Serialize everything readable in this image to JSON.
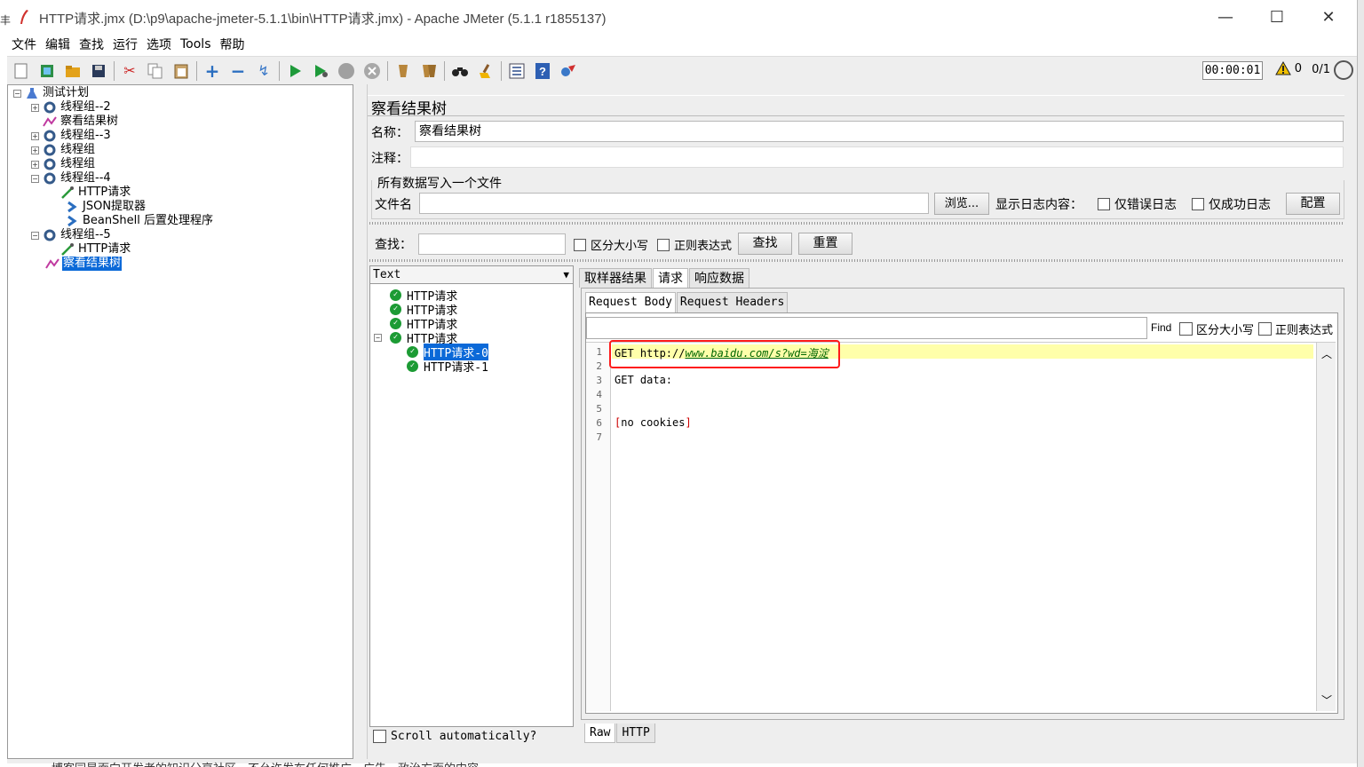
{
  "window": {
    "title": "HTTP请求.jmx (D:\\p9\\apache-jmeter-5.1.1\\bin\\HTTP请求.jmx) - Apache JMeter (5.1.1 r1855137)",
    "edge_glyph": "丰",
    "minimize": "—",
    "maximize": "☐",
    "close": "✕"
  },
  "menu": [
    "文件",
    "编辑",
    "查找",
    "运行",
    "选项",
    "Tools",
    "帮助"
  ],
  "toolbar": {
    "timer": "00:00:01",
    "warnings": "0",
    "threads": "0/1"
  },
  "tree": [
    {
      "label": "测试计划",
      "expander": "−",
      "icon": "test-plan-icon"
    },
    {
      "label": "线程组--2",
      "expander": "+",
      "icon": "gear-icon"
    },
    {
      "label": "察看结果树",
      "expander": "",
      "icon": "results-tree-icon"
    },
    {
      "label": "线程组--3",
      "expander": "+",
      "icon": "gear-icon"
    },
    {
      "label": "线程组",
      "expander": "+",
      "icon": "gear-icon"
    },
    {
      "label": "线程组",
      "expander": "+",
      "icon": "gear-icon"
    },
    {
      "label": "线程组--4",
      "expander": "−",
      "icon": "gear-icon"
    },
    {
      "label": "HTTP请求",
      "expander": "",
      "icon": "pipette-icon"
    },
    {
      "label": "JSON提取器",
      "expander": "",
      "icon": "arrow-icon"
    },
    {
      "label": "BeanShell 后置处理程序",
      "expander": "",
      "icon": "arrow-icon"
    },
    {
      "label": "线程组--5",
      "expander": "−",
      "icon": "gear-icon"
    },
    {
      "label": "HTTP请求",
      "expander": "",
      "icon": "pipette-icon"
    },
    {
      "label": "察看结果树",
      "expander": "",
      "icon": "results-tree-icon",
      "selected": true
    }
  ],
  "panel": {
    "title": "察看结果树",
    "name_label": "名称：",
    "name_value": "察看结果树",
    "comment_label": "注释：",
    "comment_value": "",
    "file_group_title": "所有数据写入一个文件",
    "file_label": "文件名",
    "file_value": "",
    "browse_button": "浏览...",
    "log_label": "显示日志内容：",
    "errors_only": "仅错误日志",
    "success_only": "仅成功日志",
    "configure_button": "配置",
    "search_label": "查找：",
    "search_value": "",
    "case_sensitive": "区分大小写",
    "regex": "正则表达式",
    "find_button": "查找",
    "reset_button": "重置"
  },
  "results": {
    "renderer": "Text",
    "rows": [
      {
        "label": "HTTP请求",
        "indent": 1
      },
      {
        "label": "HTTP请求",
        "indent": 1
      },
      {
        "label": "HTTP请求",
        "indent": 1
      },
      {
        "label": "HTTP请求",
        "indent": 1,
        "expander": "−"
      },
      {
        "label": "HTTP请求-0",
        "indent": 2,
        "selected": true
      },
      {
        "label": "HTTP请求-1",
        "indent": 2
      }
    ],
    "scroll_auto": "Scroll automatically?"
  },
  "detail": {
    "tabs": [
      "取样器结果",
      "请求",
      "响应数据"
    ],
    "active_tab": "请求",
    "inner_tabs": [
      "Request Body",
      "Request Headers"
    ],
    "find_label": "Find",
    "find_case": "区分大小写",
    "find_regex": "正则表达式",
    "code_lines": [
      "1",
      "2",
      "3",
      "4",
      "5",
      "6",
      "7"
    ],
    "line1_prefix": "GET http://",
    "line1_url": "www.baidu.com/s?wd=海淀",
    "line3": "GET data:",
    "line6_open": "[",
    "line6_text": "no cookies",
    "line6_close": "]",
    "bottom_tabs": [
      "Raw",
      "HTTP"
    ]
  },
  "footer": "博客园是面向开发者的知识分享社区，不允许发布任何推广、广告、政治方面的内容。"
}
